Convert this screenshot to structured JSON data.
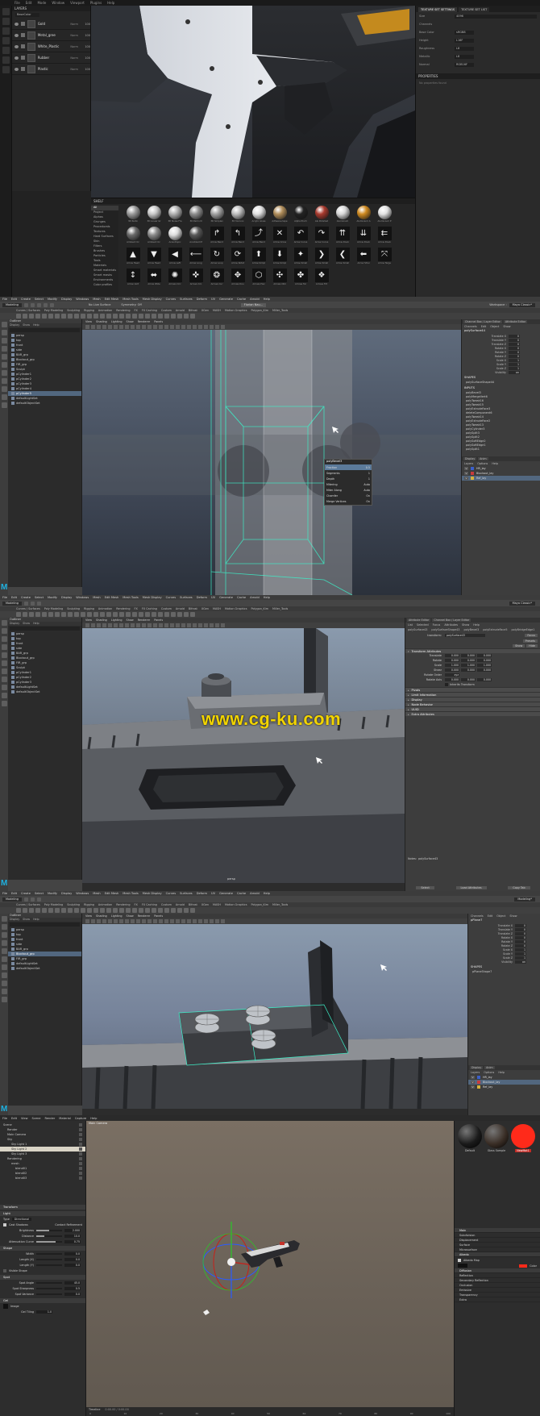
{
  "substance_painter": {
    "menu": [
      "File",
      "Edit",
      "Mode",
      "Window",
      "Viewport",
      "Plugins",
      "Help"
    ],
    "layers_panel": {
      "title": "LAYERS",
      "channel_select": "BaseColor",
      "layers": [
        {
          "name": "Gold",
          "blend": "Norm",
          "opacity": "100"
        },
        {
          "name": "Metal_gree",
          "blend": "Norm",
          "opacity": "100"
        },
        {
          "name": "White_Plastic",
          "blend": "Norm",
          "opacity": "100"
        },
        {
          "name": "Rubber",
          "blend": "Norm",
          "opacity": "100"
        },
        {
          "name": "Plastic",
          "blend": "Norm",
          "opacity": "100"
        }
      ]
    },
    "texture_set": {
      "tabs": [
        "TEXTURE SET SETTINGS",
        "TEXTURE SET LIST"
      ],
      "size_label": "Size",
      "size_value": "4096",
      "channels_label": "Channels",
      "channels": [
        {
          "name": "Base Color",
          "format": "sRGB8"
        },
        {
          "name": "Height",
          "format": "L16F"
        },
        {
          "name": "Roughness",
          "format": "L8"
        },
        {
          "name": "Metallic",
          "format": "L8"
        },
        {
          "name": "Normal",
          "format": "RGB16F"
        }
      ],
      "properties_title": "PROPERTIES",
      "properties_hint": "No properties found"
    },
    "shelf": {
      "title": "SHELF",
      "categories": [
        "All",
        "Project",
        "Alphas",
        "Grunges",
        "Procedurals",
        "Textures",
        "Hard Surfaces",
        "Skin",
        "Filters",
        "Brushes",
        "Particles",
        "Tools",
        "Materials",
        "Smart materials",
        "Smart masks",
        "Environments",
        "Color profiles"
      ],
      "items": [
        {
          "name": "3D Perlin",
          "kind": "ball",
          "color": "#9a9a9a"
        },
        {
          "name": "3D Linear Gr",
          "kind": "ball",
          "color": "#c8c8c8"
        },
        {
          "name": "3D Noise Fra",
          "kind": "ball",
          "color": "#b0b0b0"
        },
        {
          "name": "3D Perlin N",
          "kind": "ball",
          "color": "#8c8c8c"
        },
        {
          "name": "3D Simplex",
          "kind": "ball",
          "color": "#a0a0a0"
        },
        {
          "name": "3D Voronoi",
          "kind": "ball",
          "color": "#bcbcbc"
        },
        {
          "name": "Acrylic Gloss",
          "kind": "ball",
          "color": "#e0e0e0"
        },
        {
          "name": "Adhesive tape",
          "kind": "ball",
          "color": "#b08d5a"
        },
        {
          "name": "Alpha Pinch",
          "kind": "ball",
          "color": "#222222"
        },
        {
          "name": "Alu Polished",
          "kind": "ball",
          "color": "#a83a2e"
        },
        {
          "name": "Aluminium",
          "kind": "ball",
          "color": "#d8d8d8"
        },
        {
          "name": "Aluminium A",
          "kind": "ball",
          "color": "#cf8a20"
        },
        {
          "name": "Aluminium P",
          "kind": "ball",
          "color": "#e3e3e3"
        },
        {
          "name": "Ambient Oc",
          "kind": "ball",
          "color": "#6a6a6a"
        },
        {
          "name": "Ambient Oc",
          "kind": "ball",
          "color": "#8a8a8a"
        },
        {
          "name": "Anisotropic",
          "kind": "ball",
          "color": "#dddddd"
        },
        {
          "name": "Anodized M",
          "kind": "ball",
          "color": "#585858"
        },
        {
          "name": "Arrow Bend",
          "kind": "icon",
          "glyph": "↱"
        },
        {
          "name": "Arrow Bend",
          "kind": "icon",
          "glyph": "↰"
        },
        {
          "name": "Arrow Bend",
          "kind": "icon",
          "glyph": "⤴"
        },
        {
          "name": "Arrow Cross",
          "kind": "icon",
          "glyph": "✕"
        },
        {
          "name": "Arrow Curve",
          "kind": "icon",
          "glyph": "↶"
        },
        {
          "name": "Arrow Curve",
          "kind": "icon",
          "glyph": "↷"
        },
        {
          "name": "Arrow Doub",
          "kind": "icon",
          "glyph": "⇈"
        },
        {
          "name": "Arrow Doub",
          "kind": "icon",
          "glyph": "⇊"
        },
        {
          "name": "Arrow Doub",
          "kind": "icon",
          "glyph": "⇇"
        },
        {
          "name": "Arrow Head",
          "kind": "icon",
          "glyph": "▲"
        },
        {
          "name": "Arrow Head",
          "kind": "icon",
          "glyph": "▼"
        },
        {
          "name": "Arrow Left",
          "kind": "icon",
          "glyph": "◀"
        },
        {
          "name": "Arrow Long",
          "kind": "icon",
          "glyph": "⟵"
        },
        {
          "name": "Arrow Loop",
          "kind": "icon",
          "glyph": "↻"
        },
        {
          "name": "Arrow Rotat",
          "kind": "icon",
          "glyph": "⟳"
        },
        {
          "name": "Arrow Simpl",
          "kind": "icon",
          "glyph": "⬆"
        },
        {
          "name": "Arrow Simpl",
          "kind": "icon",
          "glyph": "⬇"
        },
        {
          "name": "Arrow Small",
          "kind": "icon",
          "glyph": "✦"
        },
        {
          "name": "Arrow Small",
          "kind": "icon",
          "glyph": "❯"
        },
        {
          "name": "Arrow Small",
          "kind": "icon",
          "glyph": "❮"
        },
        {
          "name": "Arrow Strai",
          "kind": "icon",
          "glyph": "⬅"
        },
        {
          "name": "Arrow Targe",
          "kind": "icon",
          "glyph": "⤧"
        },
        {
          "name": "Arrow Vert",
          "kind": "icon",
          "glyph": "↕"
        },
        {
          "name": "Arrow Wide",
          "kind": "icon",
          "glyph": "⬌"
        },
        {
          "name": "Arrows Circ",
          "kind": "icon",
          "glyph": "✺"
        },
        {
          "name": "Arrows Cro",
          "kind": "icon",
          "glyph": "✜"
        },
        {
          "name": "Arrows Cur",
          "kind": "icon",
          "glyph": "❂"
        },
        {
          "name": "Arrows Dou",
          "kind": "icon",
          "glyph": "✥"
        },
        {
          "name": "Arrows Hex",
          "kind": "icon",
          "glyph": "⬡"
        },
        {
          "name": "Arrows Obli",
          "kind": "icon",
          "glyph": "✣"
        },
        {
          "name": "Arrows Tar",
          "kind": "icon",
          "glyph": "✤"
        },
        {
          "name": "Arrows Tilt",
          "kind": "icon",
          "glyph": "❖"
        }
      ]
    }
  },
  "maya1": {
    "menu": [
      "File",
      "Edit",
      "Create",
      "Select",
      "Modify",
      "Display",
      "Windows",
      "Mesh",
      "Edit Mesh",
      "Mesh Tools",
      "Mesh Display",
      "Curves",
      "Surfaces",
      "Deform",
      "UV",
      "Generate",
      "Cache",
      "Arnold",
      "Help"
    ],
    "workspace": "Workspace :",
    "workspace_value": "Maya Classic*",
    "mode_select": "Modeling",
    "live_surface": "No Live Surface",
    "symmetry": "Symmetry: Off",
    "user_name": "Florian Nau...",
    "shelf_tabs": [
      "Curves / Surfaces",
      "Poly Modeling",
      "Sculpting",
      "Rigging",
      "Animation",
      "Rendering",
      "FX",
      "FX Caching",
      "Custom",
      "Arnold",
      "Bifrost",
      "XGen",
      "MASH",
      "Motion Graphics",
      "Polygon_Kim",
      "Miller_Tools"
    ],
    "active_shelf": "Modeling",
    "outliner": {
      "title": "Outliner",
      "menu": [
        "Display",
        "Show",
        "Help"
      ],
      "items": [
        "persp",
        "top",
        "front",
        "side",
        "BAR_grp",
        "Blockout_grp",
        "FIR_grp",
        "Sculpt",
        "pCylinder1",
        "pCylinder2",
        "pCylinder3",
        "pCylinder4",
        "pCylinder5",
        "defaultLightSet",
        "defaultObjectSet"
      ],
      "selected": "pCylinder5"
    },
    "viewport_menu": [
      "View",
      "Shading",
      "Lighting",
      "Show",
      "Renderer",
      "Panels"
    ],
    "bevel_popup": {
      "title": "polyBevel3",
      "rows": [
        "Fraction",
        "Segments",
        "Depth",
        "Mitering",
        "Miter Along",
        "Chamfer",
        "Merge Vertices"
      ],
      "values": [
        "0.5",
        "1",
        "1",
        "Auto",
        "Auto",
        "On",
        "On"
      ]
    },
    "channel_box": {
      "tabs": [
        "Channel Box / Layer Editor",
        "Attribute Editor"
      ],
      "menu": [
        "Channels",
        "Edit",
        "Object",
        "Show"
      ],
      "object": "polySurface44",
      "attrs": [
        "Translate X",
        "Translate Y",
        "Translate Z",
        "Rotate X",
        "Rotate Y",
        "Rotate Z",
        "Scale X",
        "Scale Y",
        "Scale Z",
        "Visibility"
      ],
      "values": [
        "0",
        "0",
        "0",
        "0",
        "0",
        "0",
        "1",
        "1",
        "1",
        "on"
      ],
      "shapes_label": "SHAPES",
      "shape": "polySurfaceShape44",
      "inputs_label": "INPUTS",
      "inputs": [
        "polyBevel3",
        "polyMergeVert6",
        "polyTweak16",
        "polyTweak15",
        "polyExtrudeFace3",
        "deleteComponent6",
        "polyTweak14",
        "polyExtrudeFace2",
        "polyTweak13",
        "polyCylinder3",
        "polySplit3",
        "polySplit2",
        "polySoftEdge2",
        "polySoftEdge1",
        "polySplit1"
      ],
      "layer_tabs": [
        "Display",
        "Anim"
      ],
      "layer_menu": [
        "Layers",
        "Options",
        "Help"
      ],
      "layers": [
        {
          "name": "HR_lay",
          "color": "#3b5fc9"
        },
        {
          "name": "Blockout_lay",
          "color": "#c93b3b"
        },
        {
          "name": "Ref_lay",
          "color": "#d6b23c"
        }
      ],
      "selected_layer": "Ref_lay"
    },
    "stats": [
      "Verts:",
      "Edges:",
      "Faces:",
      "Tris:",
      "UVs:"
    ]
  },
  "maya2": {
    "menu": [
      "File",
      "Edit",
      "Create",
      "Select",
      "Modify",
      "Display",
      "Windows",
      "Mesh",
      "Edit Mesh",
      "Mesh Tools",
      "Mesh Display",
      "Curves",
      "Surfaces",
      "Deform",
      "UV",
      "Generate",
      "Cache",
      "Arnold",
      "Help"
    ],
    "workspace_value": "Maya Classic*",
    "mode_select": "Modeling",
    "active_shelf": "Modeling",
    "outliner": {
      "title": "Outliner",
      "menu": [
        "Display",
        "Show",
        "Help"
      ],
      "items": [
        "persp",
        "top",
        "front",
        "side",
        "BAR_grp",
        "Blockout_grp",
        "FIR_grp",
        "Sculpt",
        "pCylinder1",
        "pCylinder2",
        "pCylinder3",
        "defaultLightSet",
        "defaultObjectSet"
      ]
    },
    "watermark": "www.cg-ku.com",
    "bottom_label": "persp",
    "attribute_editor": {
      "tabs": [
        "Attribute Editor",
        "Channel Box / Layer Editor"
      ],
      "menu": [
        "List",
        "Selected",
        "Focus",
        "Attributes",
        "Show",
        "Help"
      ],
      "node_tabs": [
        "polySurface43",
        "polySurfaceShape43",
        "polyBevel3",
        "polyExtrudeFace5",
        "polyBridgeEdge1"
      ],
      "transform_label": "transform:",
      "transform_value": "polySurface43",
      "focus_btn": "Focus",
      "presets_btn": "Presets",
      "show_btn": "Show",
      "hide_btn": "Hide",
      "section_open": "Transform Attributes",
      "fields": [
        {
          "label": "Translate",
          "v": [
            "0.000",
            "0.000",
            "0.000"
          ]
        },
        {
          "label": "Rotate",
          "v": [
            "0.000",
            "0.000",
            "0.000"
          ]
        },
        {
          "label": "Scale",
          "v": [
            "1.000",
            "1.000",
            "1.000"
          ]
        },
        {
          "label": "Shear",
          "v": [
            "0.000",
            "0.000",
            "0.000"
          ]
        },
        {
          "label": "Rotate Order",
          "v": [
            "xyz"
          ]
        },
        {
          "label": "Rotate Axis",
          "v": [
            "0.000",
            "0.000",
            "0.000"
          ]
        }
      ],
      "inherits": "Inherits Transform",
      "sections": [
        "Pivots",
        "Limit Information",
        "Display",
        "Node Behavior",
        "UUID",
        "Extra Attributes"
      ],
      "notes_label": "Notes:",
      "notes_value": "polySurface43",
      "buttons": [
        "Select",
        "Load Attributes",
        "Copy Tab"
      ]
    }
  },
  "maya3": {
    "menu": [
      "File",
      "Edit",
      "Create",
      "Select",
      "Modify",
      "Display",
      "Windows",
      "Mesh",
      "Edit Mesh",
      "Mesh Tools",
      "Mesh Display",
      "Curves",
      "Surfaces",
      "Deform",
      "UV",
      "Generate",
      "Cache",
      "Arnold",
      "Help"
    ],
    "workspace_value": "Modeling*",
    "mode_select": "Modeling",
    "active_shelf": "Modeling",
    "outliner": {
      "title": "Outliner",
      "menu": [
        "Display",
        "Show",
        "Help"
      ],
      "items": [
        "persp",
        "top",
        "front",
        "side",
        "BAR_grp",
        "Blockout_grp",
        "FIR_grp",
        "defaultLightSet",
        "defaultObjectSet"
      ],
      "selected": "Blockout_grp"
    },
    "channel_box": {
      "menu": [
        "Channels",
        "Edit",
        "Object",
        "Show"
      ],
      "object": "pPlane7",
      "attrs": [
        "Translate X",
        "Translate Y",
        "Translate Z",
        "Rotate X",
        "Rotate Y",
        "Rotate Z",
        "Scale X",
        "Scale Y",
        "Scale Z",
        "Visibility"
      ],
      "values": [
        "0",
        "0",
        "0",
        "0",
        "0",
        "0",
        "1",
        "1",
        "1",
        "on"
      ],
      "shapes_label": "SHAPES",
      "shape": "pPlaneShape7",
      "layer_tabs": [
        "Display",
        "Anim"
      ],
      "layer_menu": [
        "Layers",
        "Options",
        "Help"
      ],
      "layers": [
        {
          "name": "HR_lay",
          "color": "#3b5fc9"
        },
        {
          "name": "Blockout_lay",
          "color": "#c93b3b"
        },
        {
          "name": "Ref_lay",
          "color": "#d6b23c"
        }
      ],
      "selected_layer": "Blockout_lay"
    }
  },
  "marmoset": {
    "menu": [
      "File",
      "Edit",
      "View",
      "Scene",
      "Render",
      "Material",
      "Capture",
      "Help"
    ],
    "viewport_label": "Main Camera",
    "scene_tree": [
      "Scene",
      "Render",
      "Main Camera",
      "Sky",
      "Sky Light 1",
      "Sky Light 2",
      "Sky Light 3",
      "Rendering",
      "mesh",
      "blend01",
      "blend02",
      "blend03"
    ],
    "selected_node": "Sky Light 2",
    "transform_hdr": "Transform",
    "light_hdr": "Light",
    "light_type_label": "Type",
    "light_type": "Directional",
    "cast_shadows": "Cast Shadows",
    "contact_refinement": "Contact Refinement",
    "fields": [
      {
        "label": "Brightness",
        "value": "2.000",
        "fill": 0.5
      },
      {
        "label": "Distance",
        "value": "10.0",
        "fill": 0.3
      },
      {
        "label": "Attenuation Curve",
        "value": "0.75",
        "fill": 0.75
      }
    ],
    "shape_hdr": "Shape",
    "shape_fields": [
      {
        "label": "Width",
        "value": "0.0"
      },
      {
        "label": "Length (X)",
        "value": "0.0"
      },
      {
        "label": "Length (Y)",
        "value": "0.0"
      }
    ],
    "visible_shape": "Visible Shape",
    "spot_hdr": "Spot",
    "spot_fields": [
      {
        "label": "Spot Angle",
        "value": "45.0"
      },
      {
        "label": "Spot Sharpness",
        "value": "0.5"
      },
      {
        "label": "Spot Variance",
        "value": "0.0"
      }
    ],
    "gel_hdr": "Gel",
    "gel_image": "Image",
    "gel_tiling": "Gel Tiling",
    "gel_tiling_value": "1.0",
    "materials": [
      {
        "name": "Default",
        "color": "#1a1a1a"
      },
      {
        "name": "Glass Sample",
        "color": "#3a2e26"
      },
      {
        "name": "NewMat1",
        "color": "#ff2a1a"
      }
    ],
    "selected_material": "NewMat1",
    "material_sections": [
      "Main",
      "Subdivision",
      "Displacement",
      "Surface",
      "Microsurface",
      "Albedo"
    ],
    "albedo_map": "Albedo Map",
    "color_label": "Color",
    "material_sections2": [
      "Diffusion",
      "Reflection",
      "Secondary Reflection",
      "Occlusion",
      "Emissive",
      "Transparency",
      "Extra"
    ],
    "timeline_label": "Timeline",
    "frame_info": "0:00.00 / 0:00.00",
    "frame_ticks": [
      "0",
      "10",
      "20",
      "30",
      "40",
      "50",
      "60",
      "70",
      "80",
      "90",
      "100"
    ]
  }
}
